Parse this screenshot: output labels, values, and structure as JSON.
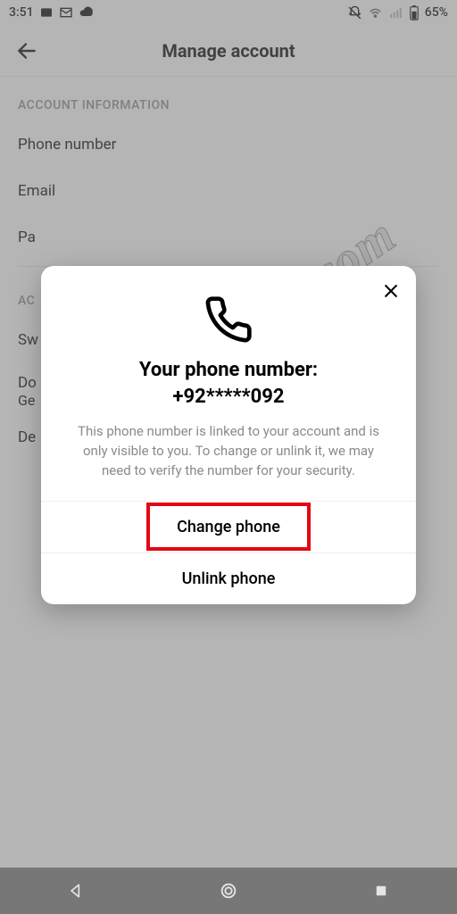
{
  "status": {
    "time": "3:51",
    "battery": "65%"
  },
  "header": {
    "title": "Manage account"
  },
  "sections": {
    "info_label": "ACCOUNT INFORMATION",
    "control_label": "AC",
    "rows": {
      "phone": "Phone number",
      "email": "Email",
      "password": "Pa",
      "switch": "Sw",
      "download": "Do",
      "download_sub": "Ge",
      "delete": "De"
    }
  },
  "modal": {
    "title_line1": "Your phone number:",
    "title_line2": "+92*****092",
    "description": "This phone number is linked to your account and is only visible to you. To change or unlink it, we may need to verify the number for your security.",
    "change": "Change phone",
    "unlink": "Unlink phone"
  },
  "watermark": "Howtoscoach.com"
}
